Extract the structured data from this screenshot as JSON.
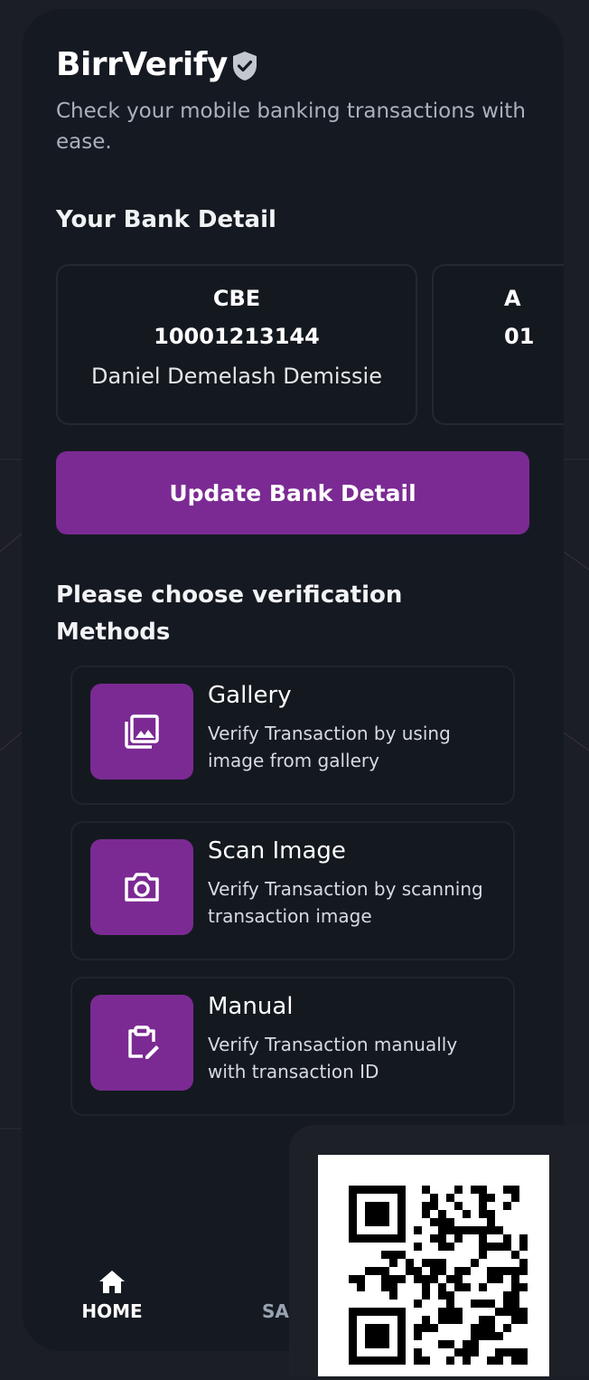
{
  "app": {
    "name": "BirrVerify",
    "tagline": "Check your mobile banking transactions with ease."
  },
  "bank_section": {
    "title": "Your Bank Detail",
    "cards": [
      {
        "bank": "CBE",
        "account": "10001213144",
        "holder": "Daniel Demelash Demissie"
      },
      {
        "bank": "A",
        "account": "01",
        "holder": ""
      }
    ],
    "update_button": "Update Bank Detail"
  },
  "methods_section": {
    "title": "Please choose verification Methods",
    "items": [
      {
        "title": "Gallery",
        "description": "Verify Transaction by using image from gallery",
        "icon": "gallery-icon"
      },
      {
        "title": "Scan Image",
        "description": "Verify Transaction by scanning transaction image",
        "icon": "camera-icon"
      },
      {
        "title": "Manual",
        "description": "Verify Transaction manually with transaction ID",
        "icon": "clipboard-edit-icon"
      }
    ]
  },
  "bottom_nav": {
    "items": [
      {
        "label": "HOME",
        "icon": "home-icon",
        "active": true
      },
      {
        "label": "SA",
        "icon": "saved-icon",
        "active": false
      }
    ]
  },
  "colors": {
    "background": "#1b1e25",
    "panel": "#151a22",
    "accent": "#7b2a93",
    "text_primary": "#ffffff",
    "text_secondary": "#aab1bd"
  }
}
